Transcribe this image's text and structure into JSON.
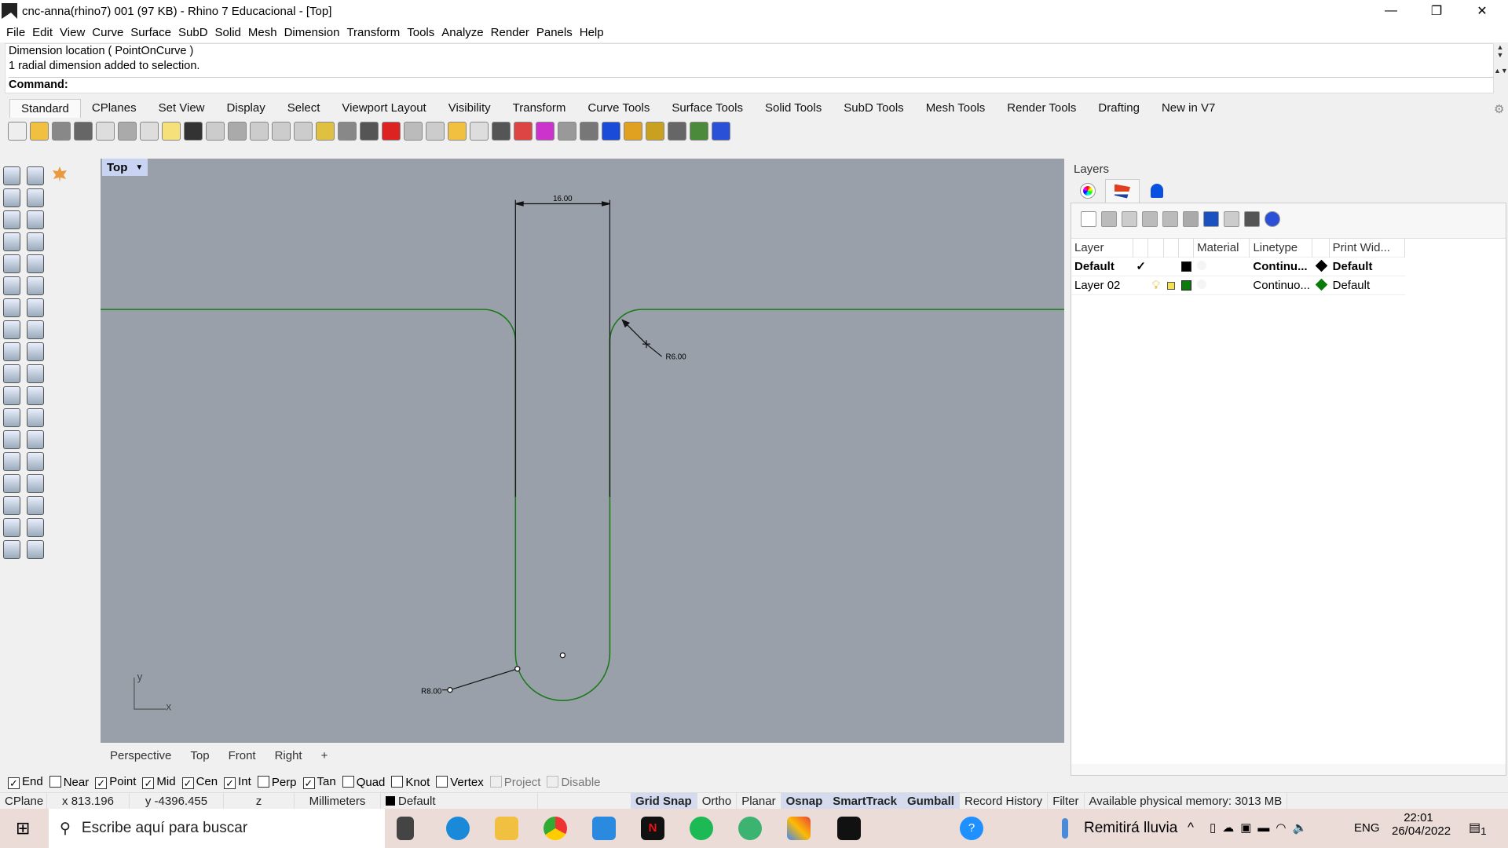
{
  "window": {
    "title": "cnc-anna(rhino7) 001 (97 KB) - Rhino 7 Educacional - [Top]",
    "minimize": "—",
    "restore": "❐",
    "close": "✕"
  },
  "menu": [
    "File",
    "Edit",
    "View",
    "Curve",
    "Surface",
    "SubD",
    "Solid",
    "Mesh",
    "Dimension",
    "Transform",
    "Tools",
    "Analyze",
    "Render",
    "Panels",
    "Help"
  ],
  "command": {
    "history": [
      "Dimension location ( PointOnCurve )",
      "1 radial dimension added to selection."
    ],
    "prompt": "Command:",
    "value": ""
  },
  "toolbar_tabs": [
    "Standard",
    "CPlanes",
    "Set View",
    "Display",
    "Select",
    "Viewport Layout",
    "Visibility",
    "Transform",
    "Curve Tools",
    "Surface Tools",
    "Solid Tools",
    "SubD Tools",
    "Mesh Tools",
    "Render Tools",
    "Drafting",
    "New in V7"
  ],
  "active_toolbar_tab": "Standard",
  "toolbar_icons": [
    "new-icon",
    "open-icon",
    "save-icon",
    "print-icon",
    "import-icon",
    "cut-icon",
    "copy-icon",
    "paste-icon",
    "undo-icon",
    "pan-icon",
    "rotate-view-icon",
    "zoom-icon",
    "zoom-window-icon",
    "zoom-extents-icon",
    "zoom-selected-icon",
    "undo-view-icon",
    "four-viewports-icon",
    "car-icon",
    "grid-icon",
    "cplane-icon",
    "points-icon",
    "light-icon",
    "lock-icon",
    "layers-icon",
    "color-wheel-icon",
    "shaded-icon",
    "rendered-icon",
    "sphere-icon",
    "spotlight-icon",
    "options-icon",
    "dimension-icon",
    "globe-icon",
    "help-icon"
  ],
  "left_toolbar_icons": [
    "select-icon",
    "point-icon",
    "polyline-icon",
    "curve-icon",
    "circle-icon",
    "ellipse-icon",
    "polygon-icon",
    "rectangle-icon",
    "arc-icon",
    "fillet-icon",
    "surface-icon",
    "extrude-icon",
    "box-icon",
    "boolean-icon",
    "cylinder-icon",
    "plane-icon",
    "gear-icon",
    "explode-icon",
    "trim-icon",
    "split-icon",
    "group-icon",
    "join-icon",
    "offset-icon",
    "blend-icon",
    "text-icon",
    "scale-icon",
    "array-icon",
    "align-icon",
    "block-icon",
    "dimension-icon",
    "grid-icon",
    "move-icon",
    "analyze-icon",
    "check-icon",
    "render-icon",
    "material-icon"
  ],
  "viewport": {
    "name": "Top",
    "dimension_label": "16.00",
    "radius_label_1": "R6.00",
    "radius_label_2": "R8.00",
    "axis_x": "x",
    "axis_y": "y",
    "curve_color": "#1a7a1a",
    "background": "#9aa0aa"
  },
  "viewport_tabs": [
    "Perspective",
    "Top",
    "Front",
    "Right"
  ],
  "osnaps": [
    {
      "label": "End",
      "checked": true
    },
    {
      "label": "Near",
      "checked": false
    },
    {
      "label": "Point",
      "checked": true
    },
    {
      "label": "Mid",
      "checked": true
    },
    {
      "label": "Cen",
      "checked": true
    },
    {
      "label": "Int",
      "checked": true
    },
    {
      "label": "Perp",
      "checked": false
    },
    {
      "label": "Tan",
      "checked": true
    },
    {
      "label": "Quad",
      "checked": false
    },
    {
      "label": "Knot",
      "checked": false
    },
    {
      "label": "Vertex",
      "checked": false
    },
    {
      "label": "Project",
      "checked": false,
      "disabled": true
    },
    {
      "label": "Disable",
      "checked": false,
      "disabled": true
    }
  ],
  "status": {
    "cplane": "CPlane",
    "x": "x 813.196",
    "y": "y -4396.455",
    "z": "z",
    "units": "Millimeters",
    "layer": "Default",
    "toggles": [
      {
        "label": "Grid Snap",
        "on": true
      },
      {
        "label": "Ortho",
        "on": false
      },
      {
        "label": "Planar",
        "on": false
      },
      {
        "label": "Osnap",
        "on": true
      },
      {
        "label": "SmartTrack",
        "on": true
      },
      {
        "label": "Gumball",
        "on": true
      },
      {
        "label": "Record History",
        "on": false
      },
      {
        "label": "Filter",
        "on": false
      }
    ],
    "memory": "Available physical memory: 3013 MB"
  },
  "layers": {
    "title": "Layers",
    "columns": [
      "Layer",
      "",
      "",
      "",
      "",
      "Material",
      "Linetype",
      "",
      "Print Wid..."
    ],
    "rows": [
      {
        "name": "Default",
        "current": true,
        "color": "#000000",
        "linetype": "Continu...",
        "print_color": "#000000",
        "print_width": "Default"
      },
      {
        "name": "Layer 02",
        "current": false,
        "color": "#0a7a0a",
        "linetype": "Continuo...",
        "print_color": "#0a7a0a",
        "print_width": "Default"
      }
    ]
  },
  "taskbar": {
    "search_placeholder": "Escribe aquí para buscar",
    "weather": "Remitirá lluvia",
    "language": "ENG",
    "time": "22:01",
    "date": "26/04/2022",
    "notifications": "1"
  }
}
